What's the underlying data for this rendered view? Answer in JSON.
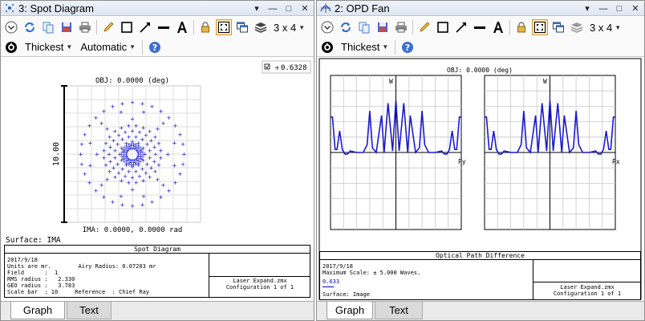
{
  "left_window": {
    "title": "3: Spot Diagram",
    "toolbar_row2": {
      "thickness": "Thickest",
      "scale": "Automatic"
    },
    "layout_label": "3 x 4",
    "legend_wavelength": "0.6328",
    "obj_label": "OBJ: 0.0000 (deg)",
    "scale_label": "10.00",
    "ima_label": "IMA: 0.0000, 0.0000 rad",
    "surface_label": "Surface: IMA",
    "info_title": "Spot Diagram",
    "info_lines": [
      "2017/9/18",
      "Units are mr.        Airy Radius: 0.07203 mr",
      "Field      :  1",
      "RMS radius :   2.330",
      "GEO radius :   3.783",
      "Scale bar  : 10     Reference  : Chief Ray"
    ],
    "file_name": "Laser Expand.zmx",
    "configuration": "Configuration 1 of 1",
    "tabs": [
      "Graph",
      "Text"
    ],
    "active_tab": "Graph"
  },
  "right_window": {
    "title": "2: OPD Fan",
    "toolbar_row2": {
      "thickness": "Thickest"
    },
    "layout_label": "3 x 4",
    "obj_label": "OBJ: 0.0000 (deg)",
    "left_plot": {
      "y_axis_label": "W",
      "x_axis_label": "Py"
    },
    "right_plot": {
      "y_axis_label": "W",
      "x_axis_label": "Px"
    },
    "info_title": "Optical Path Difference",
    "info_lines": [
      "2017/9/18",
      "Maximum Scale: ± 5.000 Waves."
    ],
    "wavelength": "0.633",
    "surface_label": "Surface: Image",
    "file_name": "Laser Expand.zmx",
    "configuration": "Configuration 1 of 1",
    "tabs": [
      "Graph",
      "Text"
    ],
    "active_tab": "Graph"
  },
  "icons": {
    "ring_colors": [
      "#0000cc"
    ],
    "fan_color": "#1a1ad0"
  },
  "chart_data": [
    {
      "type": "scatter",
      "title": "Spot Diagram",
      "units": "mr",
      "scale_bar": 10,
      "series": [
        {
          "name": "0.6328",
          "pattern": "polar rings",
          "ring_radii": [
            0.9,
            1.3,
            1.7,
            2.1,
            2.6,
            3.2,
            3.78
          ],
          "points_per_ring": [
            12,
            16,
            20,
            24,
            8,
            12,
            32
          ]
        }
      ],
      "rms_radius": 2.33,
      "geo_radius": 3.783,
      "airy_radius": 0.07203
    },
    {
      "type": "line",
      "title": "Optical Path Difference",
      "ylim": [
        -5,
        5
      ],
      "y_unit": "Waves",
      "panels": [
        {
          "xlabel": "Py",
          "x": [
            -1.0,
            -0.97,
            -0.93,
            -0.9,
            -0.86,
            -0.82,
            -0.78,
            -0.74,
            -0.7,
            -0.6,
            -0.5,
            -0.44,
            -0.4,
            -0.36,
            -0.3,
            -0.22,
            -0.18,
            -0.12,
            -0.05,
            0.0,
            0.05,
            0.12,
            0.18,
            0.22,
            0.3,
            0.36,
            0.4,
            0.44,
            0.5,
            0.6,
            0.7,
            0.74,
            0.78,
            0.82,
            0.86,
            0.9,
            0.93,
            0.97,
            1.0
          ],
          "y": [
            2.3,
            2.3,
            0.2,
            0.2,
            1.4,
            0.2,
            -0.1,
            -0.1,
            0.1,
            0.0,
            0.0,
            0.5,
            2.7,
            0.3,
            0.0,
            2.4,
            0.0,
            3.2,
            0.1,
            3.4,
            0.1,
            3.2,
            0.0,
            2.4,
            0.0,
            0.3,
            2.7,
            0.5,
            0.0,
            0.0,
            0.1,
            -0.1,
            -0.1,
            0.2,
            1.4,
            0.2,
            0.2,
            2.3,
            2.3
          ]
        },
        {
          "xlabel": "Px",
          "x": [
            -1.0,
            -0.97,
            -0.93,
            -0.9,
            -0.86,
            -0.82,
            -0.78,
            -0.74,
            -0.7,
            -0.6,
            -0.5,
            -0.44,
            -0.4,
            -0.36,
            -0.3,
            -0.22,
            -0.18,
            -0.12,
            -0.05,
            0.0,
            0.05,
            0.12,
            0.18,
            0.22,
            0.3,
            0.36,
            0.4,
            0.44,
            0.5,
            0.6,
            0.7,
            0.74,
            0.78,
            0.82,
            0.86,
            0.9,
            0.93,
            0.97,
            1.0
          ],
          "y": [
            2.3,
            2.3,
            0.2,
            0.2,
            1.4,
            0.2,
            -0.1,
            -0.1,
            0.1,
            0.0,
            0.0,
            0.5,
            2.7,
            0.3,
            0.0,
            2.4,
            0.0,
            3.2,
            0.1,
            3.4,
            0.1,
            3.2,
            0.0,
            2.4,
            0.0,
            0.3,
            2.7,
            0.5,
            0.0,
            0.0,
            0.1,
            -0.1,
            -0.1,
            0.2,
            1.4,
            0.2,
            0.2,
            2.3,
            2.3
          ]
        }
      ]
    }
  ]
}
